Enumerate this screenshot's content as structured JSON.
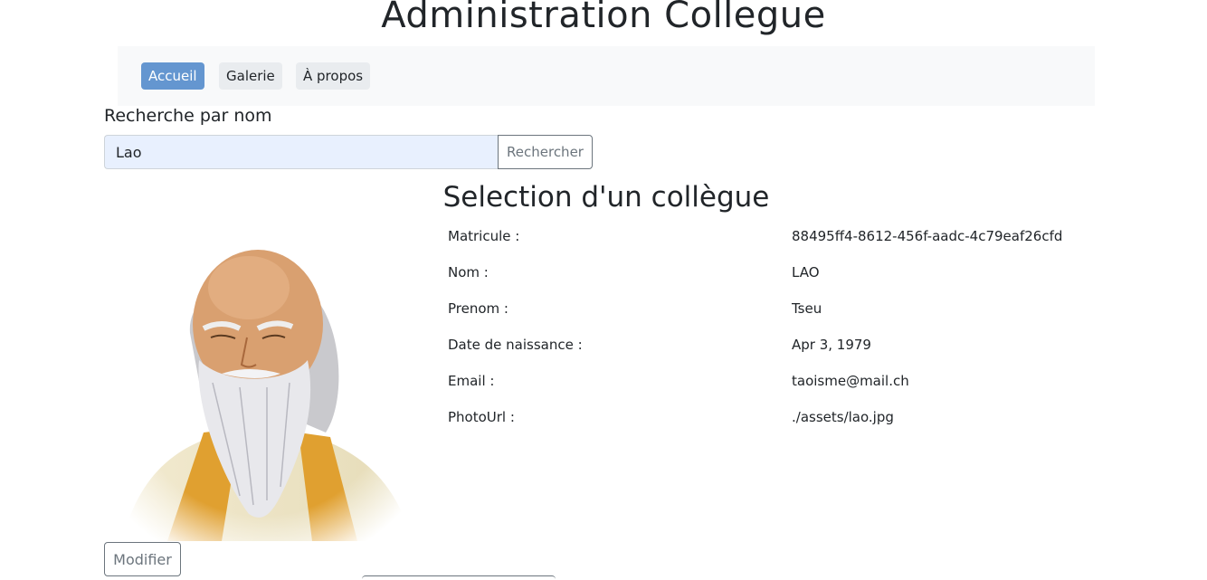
{
  "header": {
    "title": "Administration Collegue"
  },
  "nav": {
    "items": [
      {
        "label": "Accueil",
        "active": true
      },
      {
        "label": "Galerie",
        "active": false
      },
      {
        "label": "À propos",
        "active": false
      }
    ]
  },
  "search": {
    "label": "Recherche par nom",
    "value": "Lao",
    "button_label": "Rechercher"
  },
  "selection": {
    "title": "Selection d'un collègue",
    "fields": [
      {
        "label": "Matricule :",
        "value": "88495ff4-8612-456f-aadc-4c79eaf26cfd"
      },
      {
        "label": "Nom :",
        "value": "LAO"
      },
      {
        "label": "Prenom :",
        "value": "Tseu"
      },
      {
        "label": "Date de naissance :",
        "value": "Apr 3, 1979"
      },
      {
        "label": "Email :",
        "value": "taoisme@mail.ch"
      },
      {
        "label": "PhotoUrl :",
        "value": "./assets/lao.jpg"
      }
    ],
    "modify_label": "Modifier"
  },
  "colors": {
    "nav_active": "#6496d0",
    "nav_bg": "#f8f9fa",
    "input_bg": "#e8f0fe",
    "button_outline": "#6c757d"
  }
}
